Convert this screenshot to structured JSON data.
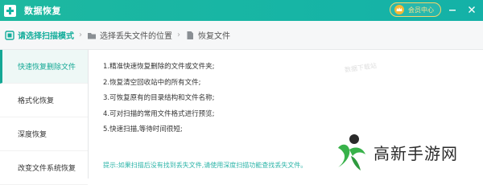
{
  "window": {
    "title": "数据恢复",
    "member_label": "会员中心"
  },
  "steps": [
    {
      "label": "请选择扫描模式",
      "active": true
    },
    {
      "label": "选择丢失文件的位置",
      "active": false
    },
    {
      "label": "恢复文件",
      "active": false
    }
  ],
  "sidebar": {
    "items": [
      {
        "label": "快速恢复删除文件",
        "active": true
      },
      {
        "label": "格式化恢复",
        "active": false
      },
      {
        "label": "深度恢复",
        "active": false
      },
      {
        "label": "改变文件系统恢复",
        "active": false
      }
    ]
  },
  "content": {
    "lines": [
      "1.精准快速恢复删除的文件或文件夹;",
      "2.恢复清空回收站中的所有文件;",
      "3.可恢复原有的目录结构和文件名称;",
      "4.可对扫描的常用文件格式进行预览;",
      "5.快速扫描,等待时间很短;"
    ],
    "hint": "提示:如果扫描后没有找到丢失文件,请使用深度扫描功能查找丢失文件。",
    "faint_watermark": "数据下载站"
  },
  "brand": {
    "text": "高新手游网"
  },
  "colors": {
    "accent": "#14ad9b",
    "titlebar": "#17b5a5",
    "hint": "#2cb4a8",
    "member_border": "#f7d46a"
  }
}
